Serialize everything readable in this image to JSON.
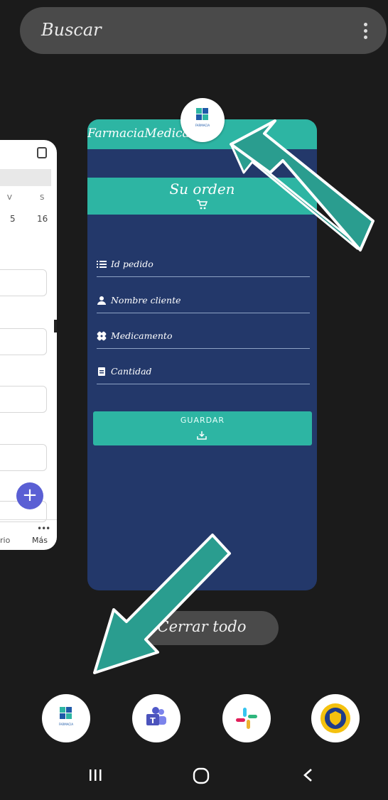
{
  "search": {
    "placeholder": "Buscar"
  },
  "left_card": {
    "days": [
      "V",
      "S"
    ],
    "dates": [
      "5",
      "16"
    ],
    "fab": "+",
    "nav_partial": "rio",
    "nav_more": "Más"
  },
  "app": {
    "title": "FarmaciaMedica",
    "order_title": "Su orden",
    "fields": [
      {
        "label": "Id pedido",
        "icon": "list-icon"
      },
      {
        "label": "Nombre cliente",
        "icon": "person-icon"
      },
      {
        "label": "Medicamento",
        "icon": "bandage-icon"
      },
      {
        "label": "Cantidad",
        "icon": "document-icon"
      }
    ],
    "save_label": "GUARDAR",
    "logo_text": "FARMACIA"
  },
  "close_all": {
    "label": "Cerrar todo"
  },
  "dock": {
    "apps": [
      {
        "name": "farmacia-app",
        "icon": "farmacia-logo",
        "text": "FARMACIA"
      },
      {
        "name": "teams-app",
        "icon": "teams-icon"
      },
      {
        "name": "slack-app",
        "icon": "slack-icon"
      },
      {
        "name": "university-app",
        "icon": "crest-icon"
      }
    ]
  },
  "colors": {
    "accent": "#2db5a3",
    "card_bg": "#23386a",
    "background": "#1b1b1b",
    "arrow": "#2a9d8f"
  }
}
